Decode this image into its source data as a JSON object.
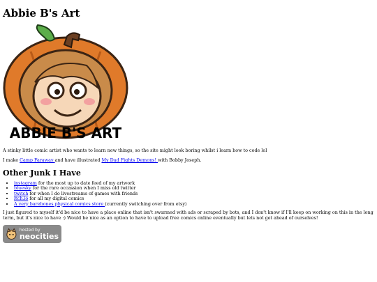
{
  "header": {
    "title": "Abbie B's Art"
  },
  "logo": {
    "text": "ABBIE B'S ART"
  },
  "intro": {
    "text": "A stinky little comic artist who wants to learn new things, so the site might look boring whilst i learn how to code lol"
  },
  "make": {
    "prefix": "I make ",
    "camp_link": "Camp Faraway ",
    "middle": "and have illustrated ",
    "book_link": "My Dad Fights Demons! ",
    "suffix": "with Bobby Joseph."
  },
  "junk": {
    "heading": "Other Junk I Have",
    "items": [
      {
        "link": "instagram",
        "text": " for the most up to date feed of my artwork"
      },
      {
        "link": "bluesky",
        "text": " for the rare occassion when I miss old twitter"
      },
      {
        "link": "twitch",
        "text": " for when I do livestreams of games with friends"
      },
      {
        "link": "itch.io",
        "text": " for all my digital comics"
      },
      {
        "link": "A very barebones physical comics store ",
        "text": "(currently switching over from etsy)"
      }
    ]
  },
  "outro": {
    "text": "I just figured to myself it'd be nice to have a place online that isn't swarmed with ads or scraped by bots, and I don't know if I'll keep on working on this in the long term, but it's nice to have :) Would be nice as an option to have to upload free comics online eventually but lets not get ahead of ourselves!"
  },
  "badge": {
    "small": "hosted by",
    "big": "neocities"
  },
  "colors": {
    "link": "#0000ee",
    "pumpkin": "#e07a2a",
    "hair": "#c98b4a"
  }
}
